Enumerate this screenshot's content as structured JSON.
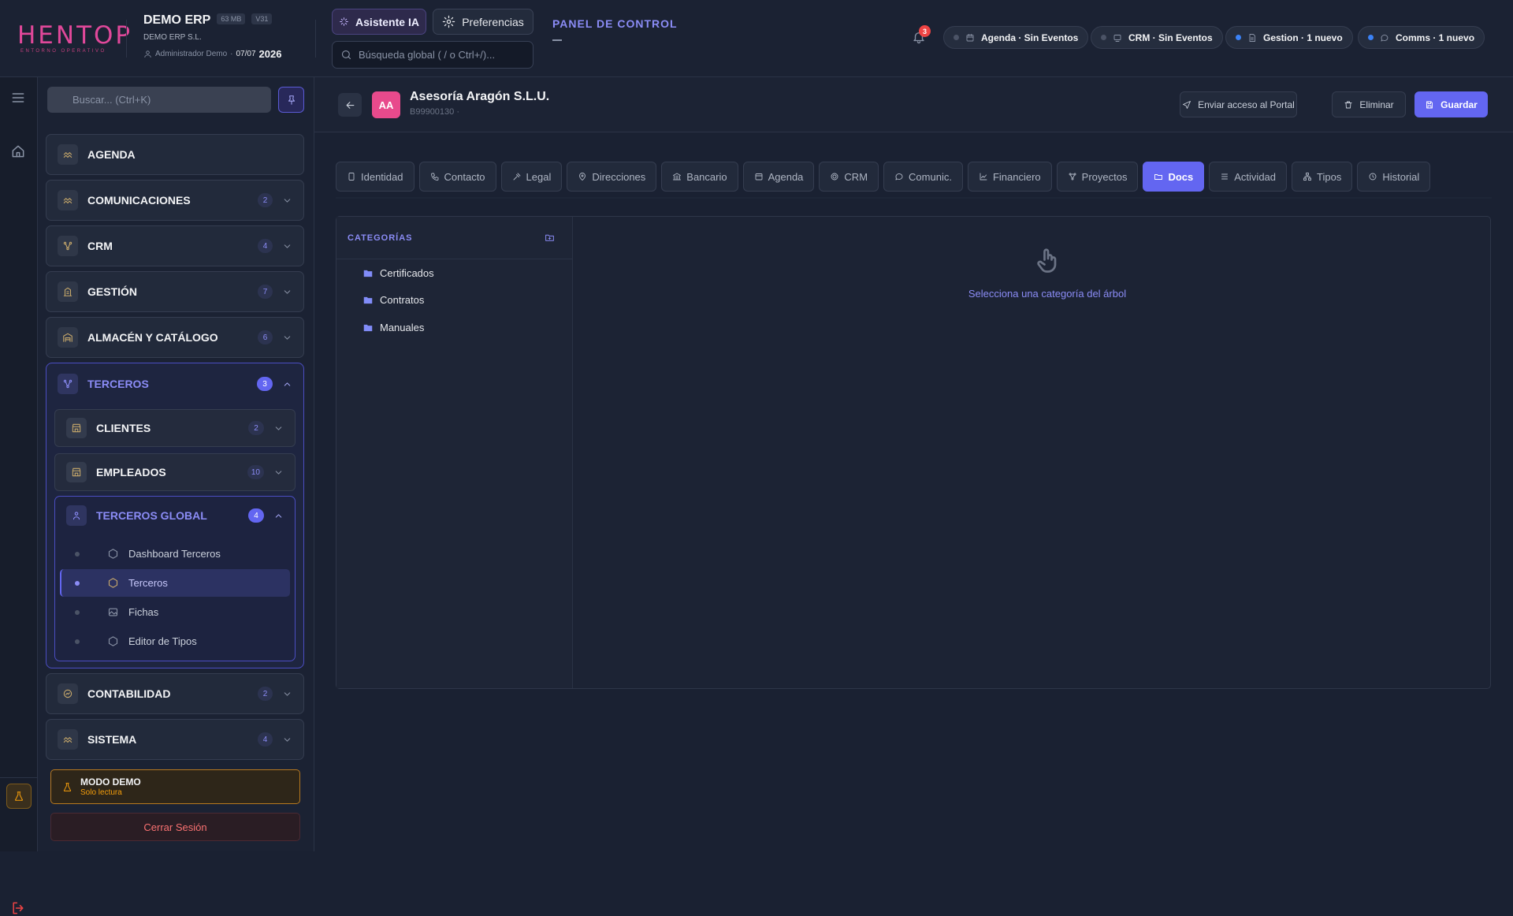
{
  "brand": {
    "logo": "HENTOP",
    "tagline": "ENTORNO OPERATIVO"
  },
  "company": {
    "name": "DEMO ERP",
    "size_badge": "63 MB",
    "version_badge": "V31",
    "legal_name": "DEMO ERP S.L.",
    "user": "Administrador Demo",
    "date": "07/07",
    "year": "2026"
  },
  "header": {
    "ai_button": "Asistente IA",
    "prefs_button": "Preferencias",
    "search_placeholder": "Búsqueda global ( / o Ctrl+/)...",
    "panel_title": "PANEL DE CONTROL",
    "panel_subtitle": "—",
    "notification_count": "3",
    "pills": [
      {
        "label": "Agenda · Sin Eventos",
        "dot_color": "#4b5366"
      },
      {
        "label": "CRM · Sin Eventos",
        "dot_color": "#4b5366"
      },
      {
        "label": "Gestion · 1 nuevo",
        "dot_color": "#3b82f6"
      },
      {
        "label": "Comms · 1 nuevo",
        "dot_color": "#3b82f6"
      }
    ]
  },
  "sidebar": {
    "search_placeholder": "Buscar... (Ctrl+K)",
    "items": [
      {
        "label": "AGENDA",
        "count": ""
      },
      {
        "label": "COMUNICACIONES",
        "count": "2"
      },
      {
        "label": "CRM",
        "count": "4"
      },
      {
        "label": "GESTIÓN",
        "count": "7"
      },
      {
        "label": "ALMACÉN Y CATÁLOGO",
        "count": "6"
      }
    ],
    "terceros": {
      "label": "TERCEROS",
      "count": "3",
      "clientes": {
        "label": "CLIENTES",
        "count": "2"
      },
      "empleados": {
        "label": "EMPLEADOS",
        "count": "10"
      },
      "global": {
        "label": "TERCEROS GLOBAL",
        "count": "4",
        "leaves": [
          "Dashboard Terceros",
          "Terceros",
          "Fichas",
          "Editor de Tipos"
        ],
        "active_leaf": "Terceros"
      }
    },
    "after": [
      {
        "label": "CONTABILIDAD",
        "count": "2"
      },
      {
        "label": "SISTEMA",
        "count": "4"
      }
    ],
    "demo_title": "MODO DEMO",
    "demo_subtitle": "Solo lectura",
    "logout": "Cerrar Sesión"
  },
  "record": {
    "initials": "AA",
    "name": "Asesoría Aragón S.L.U.",
    "id": "B99900130 ·",
    "actions": {
      "portal": "Enviar acceso al Portal",
      "delete": "Eliminar",
      "save": "Guardar"
    }
  },
  "tabs": [
    "Identidad",
    "Contacto",
    "Legal",
    "Direcciones",
    "Bancario",
    "Agenda",
    "CRM",
    "Comunic.",
    "Financiero",
    "Proyectos",
    "Docs",
    "Actividad",
    "Tipos",
    "Historial"
  ],
  "active_tab": "Docs",
  "docs": {
    "categories_title": "CATEGORÍAS",
    "categories": [
      "Certificados",
      "Contratos",
      "Manuales"
    ],
    "empty_message": "Selecciona una categoría del árbol"
  },
  "colors": {
    "accent": "#6366f1",
    "brand": "#e0489a",
    "warning": "#f59e0b",
    "danger": "#ef4444"
  }
}
